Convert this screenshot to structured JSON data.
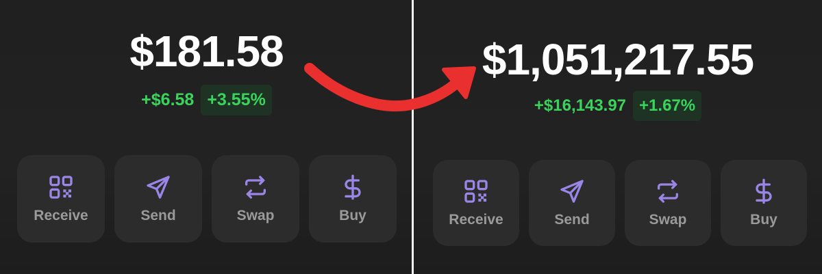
{
  "before": {
    "balance": "$181.58",
    "change_amount": "+$6.58",
    "change_percent": "+3.55%",
    "actions": [
      {
        "label": "Receive",
        "icon": "qr-code-icon"
      },
      {
        "label": "Send",
        "icon": "send-icon"
      },
      {
        "label": "Swap",
        "icon": "swap-icon"
      },
      {
        "label": "Buy",
        "icon": "dollar-icon"
      }
    ]
  },
  "after": {
    "balance": "$1,051,217.55",
    "change_amount": "+$16,143.97",
    "change_percent": "+1.67%",
    "actions": [
      {
        "label": "Receive",
        "icon": "qr-code-icon"
      },
      {
        "label": "Send",
        "icon": "send-icon"
      },
      {
        "label": "Swap",
        "icon": "swap-icon"
      },
      {
        "label": "Buy",
        "icon": "dollar-icon"
      }
    ]
  },
  "colors": {
    "accent_icon": "#9a86e6",
    "positive_green": "#3ad45c",
    "arrow_red": "#ea2f2f"
  }
}
